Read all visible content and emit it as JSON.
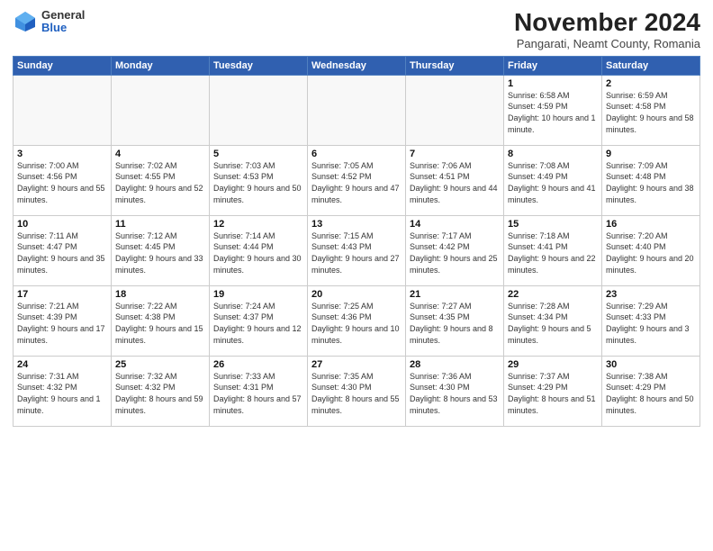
{
  "logo": {
    "general": "General",
    "blue": "Blue"
  },
  "title": "November 2024",
  "subtitle": "Pangarati, Neamt County, Romania",
  "days_header": [
    "Sunday",
    "Monday",
    "Tuesday",
    "Wednesday",
    "Thursday",
    "Friday",
    "Saturday"
  ],
  "weeks": [
    [
      {
        "day": "",
        "info": ""
      },
      {
        "day": "",
        "info": ""
      },
      {
        "day": "",
        "info": ""
      },
      {
        "day": "",
        "info": ""
      },
      {
        "day": "",
        "info": ""
      },
      {
        "day": "1",
        "info": "Sunrise: 6:58 AM\nSunset: 4:59 PM\nDaylight: 10 hours and 1 minute."
      },
      {
        "day": "2",
        "info": "Sunrise: 6:59 AM\nSunset: 4:58 PM\nDaylight: 9 hours and 58 minutes."
      }
    ],
    [
      {
        "day": "3",
        "info": "Sunrise: 7:00 AM\nSunset: 4:56 PM\nDaylight: 9 hours and 55 minutes."
      },
      {
        "day": "4",
        "info": "Sunrise: 7:02 AM\nSunset: 4:55 PM\nDaylight: 9 hours and 52 minutes."
      },
      {
        "day": "5",
        "info": "Sunrise: 7:03 AM\nSunset: 4:53 PM\nDaylight: 9 hours and 50 minutes."
      },
      {
        "day": "6",
        "info": "Sunrise: 7:05 AM\nSunset: 4:52 PM\nDaylight: 9 hours and 47 minutes."
      },
      {
        "day": "7",
        "info": "Sunrise: 7:06 AM\nSunset: 4:51 PM\nDaylight: 9 hours and 44 minutes."
      },
      {
        "day": "8",
        "info": "Sunrise: 7:08 AM\nSunset: 4:49 PM\nDaylight: 9 hours and 41 minutes."
      },
      {
        "day": "9",
        "info": "Sunrise: 7:09 AM\nSunset: 4:48 PM\nDaylight: 9 hours and 38 minutes."
      }
    ],
    [
      {
        "day": "10",
        "info": "Sunrise: 7:11 AM\nSunset: 4:47 PM\nDaylight: 9 hours and 35 minutes."
      },
      {
        "day": "11",
        "info": "Sunrise: 7:12 AM\nSunset: 4:45 PM\nDaylight: 9 hours and 33 minutes."
      },
      {
        "day": "12",
        "info": "Sunrise: 7:14 AM\nSunset: 4:44 PM\nDaylight: 9 hours and 30 minutes."
      },
      {
        "day": "13",
        "info": "Sunrise: 7:15 AM\nSunset: 4:43 PM\nDaylight: 9 hours and 27 minutes."
      },
      {
        "day": "14",
        "info": "Sunrise: 7:17 AM\nSunset: 4:42 PM\nDaylight: 9 hours and 25 minutes."
      },
      {
        "day": "15",
        "info": "Sunrise: 7:18 AM\nSunset: 4:41 PM\nDaylight: 9 hours and 22 minutes."
      },
      {
        "day": "16",
        "info": "Sunrise: 7:20 AM\nSunset: 4:40 PM\nDaylight: 9 hours and 20 minutes."
      }
    ],
    [
      {
        "day": "17",
        "info": "Sunrise: 7:21 AM\nSunset: 4:39 PM\nDaylight: 9 hours and 17 minutes."
      },
      {
        "day": "18",
        "info": "Sunrise: 7:22 AM\nSunset: 4:38 PM\nDaylight: 9 hours and 15 minutes."
      },
      {
        "day": "19",
        "info": "Sunrise: 7:24 AM\nSunset: 4:37 PM\nDaylight: 9 hours and 12 minutes."
      },
      {
        "day": "20",
        "info": "Sunrise: 7:25 AM\nSunset: 4:36 PM\nDaylight: 9 hours and 10 minutes."
      },
      {
        "day": "21",
        "info": "Sunrise: 7:27 AM\nSunset: 4:35 PM\nDaylight: 9 hours and 8 minutes."
      },
      {
        "day": "22",
        "info": "Sunrise: 7:28 AM\nSunset: 4:34 PM\nDaylight: 9 hours and 5 minutes."
      },
      {
        "day": "23",
        "info": "Sunrise: 7:29 AM\nSunset: 4:33 PM\nDaylight: 9 hours and 3 minutes."
      }
    ],
    [
      {
        "day": "24",
        "info": "Sunrise: 7:31 AM\nSunset: 4:32 PM\nDaylight: 9 hours and 1 minute."
      },
      {
        "day": "25",
        "info": "Sunrise: 7:32 AM\nSunset: 4:32 PM\nDaylight: 8 hours and 59 minutes."
      },
      {
        "day": "26",
        "info": "Sunrise: 7:33 AM\nSunset: 4:31 PM\nDaylight: 8 hours and 57 minutes."
      },
      {
        "day": "27",
        "info": "Sunrise: 7:35 AM\nSunset: 4:30 PM\nDaylight: 8 hours and 55 minutes."
      },
      {
        "day": "28",
        "info": "Sunrise: 7:36 AM\nSunset: 4:30 PM\nDaylight: 8 hours and 53 minutes."
      },
      {
        "day": "29",
        "info": "Sunrise: 7:37 AM\nSunset: 4:29 PM\nDaylight: 8 hours and 51 minutes."
      },
      {
        "day": "30",
        "info": "Sunrise: 7:38 AM\nSunset: 4:29 PM\nDaylight: 8 hours and 50 minutes."
      }
    ]
  ]
}
